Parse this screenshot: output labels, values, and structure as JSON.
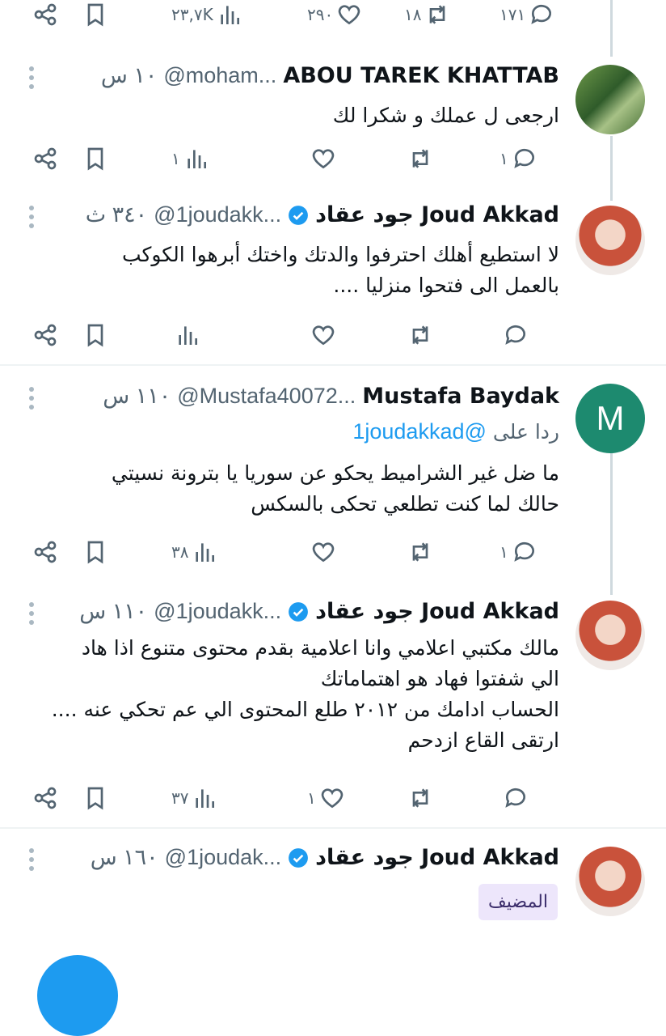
{
  "top_actions": {
    "views": "٢٣,٧K",
    "likes": "٢٩٠",
    "retweets": "١٨",
    "replies": "١٧١"
  },
  "tweets": [
    {
      "name": "ABOU TAREK KHATTAB",
      "handle": "@moham...",
      "time": "١٠ س",
      "verified": false,
      "reply_to": null,
      "lines": [
        "ارجعى ل عملك و شكرا لك"
      ],
      "views": "١",
      "likes": "",
      "retweets": "",
      "replies": "١"
    },
    {
      "name": "جود عقاد Joud Akkad",
      "handle": "@1joudakk...",
      "time": "٣٤٠ ث",
      "verified": true,
      "reply_to": null,
      "lines": [
        "لا استطيع أهلك احترفوا والدتك واختك أبرهوا الكوكب",
        "بالعمل الى فتحوا منزليا ...."
      ],
      "views": "",
      "likes": "",
      "retweets": "",
      "replies": ""
    },
    {
      "name": "Mustafa Baydak",
      "handle": "@Mustafa40072...",
      "time": "١١٠ س",
      "verified": false,
      "reply_to": {
        "prefix": "ردا على",
        "mention": "@1joudakkad"
      },
      "lines": [
        "ما ضل غير الشراميط يحكو عن سوريا يا بترونة نسيتي",
        "حالك لما كنت تطلعي تحكى بالسكس"
      ],
      "views": "٣٨",
      "likes": "",
      "retweets": "",
      "replies": "١"
    },
    {
      "name": "جود عقاد Joud Akkad",
      "handle": "@1joudakk...",
      "time": "١١٠ س",
      "verified": true,
      "reply_to": null,
      "lines": [
        "مالك مكتبي اعلامي وانا اعلامية بقدم محتوى متنوع اذا هاد",
        "الي شفتوا فهاد هو اهتماماتك",
        "الحساب ادامك من ٢٠١٢  طلع المحتوى الي عم تحكي عنه ....",
        "ارتقى القاع ازدحم"
      ],
      "views": "٣٧",
      "likes": "١",
      "retweets": "",
      "replies": ""
    },
    {
      "name": "جود عقاد Joud Akkad",
      "handle": "@1joudak...",
      "time": "١٦٠ س",
      "verified": true,
      "reply_to": null,
      "lines": [],
      "tag": "المضيف"
    }
  ],
  "avatar_letter": "M",
  "colors": {
    "accent": "#1d9bf0",
    "text": "#0f1419",
    "muted": "#536471",
    "thread": "#cfd9de"
  }
}
